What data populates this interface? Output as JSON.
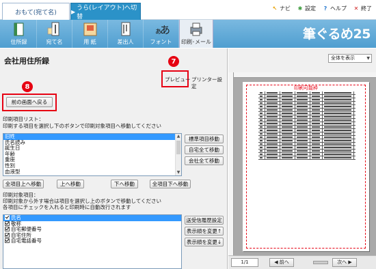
{
  "tabs": {
    "front": "おもて(宛て名)",
    "back_arrow": "▶",
    "back": "うら(レイアウト)へ切替"
  },
  "toplinks": {
    "navi": "ナビ",
    "settings": "設定",
    "help": "ヘルプ",
    "exit": "終了"
  },
  "ribbon": {
    "items": [
      "住所録",
      "宛て名",
      "用 紙",
      "差出人",
      "フォント",
      "印刷･メール"
    ],
    "brand": "筆ぐるめ25"
  },
  "left": {
    "title": "会社用住所録",
    "preview_button": "プレビュー",
    "printer_settings": "プリンター設定",
    "back_button": "前の画面へ戻る",
    "badge_preview": "7",
    "badge_back": "8",
    "items_list_label": "印刷項目リスト：",
    "items_list_desc": "印刷する項目を選択し下のボタンで印刷対象項目へ移動してください",
    "items_list": [
      "旧姓",
      "氏名読み",
      "誕生日",
      "年齢",
      "重座",
      "性別",
      "血液型"
    ],
    "btn_move_standard": "標準項目移動",
    "btn_move_home_all": "自宅全て移動",
    "btn_move_company_all": "会社全て移動",
    "btn_all_up": "全項目上へ移動",
    "btn_up": "上へ移動",
    "btn_down": "下へ移動",
    "btn_all_down": "全項目下へ移動",
    "target_label": "印刷対象項目：",
    "target_desc1": "印刷対象から外す場合は項目を選択し上のボタンで移動してください",
    "target_desc2": "各項目にチェックを入れると印刷時に自動改行されます",
    "target_list": [
      "氏名",
      "敬称",
      "自宅郵便番号",
      "自宅住所",
      "自宅電話番号"
    ],
    "btn_settings": "送受信履歴設定",
    "btn_order_up": "表示順を変更↑",
    "btn_order_down": "表示順を変更↓"
  },
  "right": {
    "zoom": "全体を表示",
    "printable_area": "印刷可能枠",
    "page": "1/1",
    "prev": "◀ 前へ",
    "next": "次へ ▶"
  },
  "colors": {
    "accent_red": "#e60012",
    "ribbon_blue": "#4f9ed0",
    "tab_blue": "#2b92c8",
    "selection": "#3399ff"
  }
}
